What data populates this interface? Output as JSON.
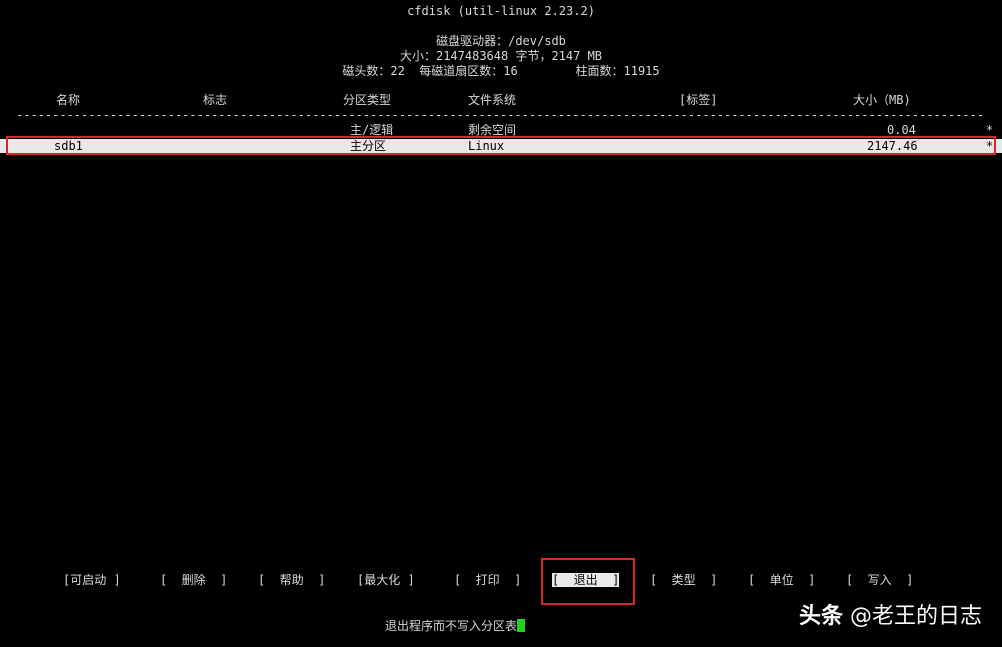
{
  "program_title": "cfdisk (util-linux 2.23.2)",
  "disk_info": {
    "drive_line": "磁盘驱动器：/dev/sdb",
    "size_line": "大小：2147483648 字节，2147 MB",
    "geometry_line": "磁头数：22  每磁道扇区数：16        柱面数：11915"
  },
  "table": {
    "columns": {
      "name": "名称",
      "flags": "标志",
      "part_type": "分区类型",
      "fs_type": "文件系统",
      "label": "[标签]",
      "size": "大小（MB)"
    },
    "divider": "----------------------------------------------------------------------------------------------------------------------------------------------------------------------------------------",
    "rows": [
      {
        "name": "",
        "flags": "",
        "part_type": "主/逻辑",
        "fs_type": "剩余空间",
        "label": "",
        "size": "0.04",
        "marker": "*"
      },
      {
        "name": "sdb1",
        "flags": "",
        "part_type": "主分区",
        "fs_type": "Linux",
        "label": "",
        "size": "2147.46",
        "marker": "*"
      }
    ]
  },
  "menu": {
    "bootable": "[可启动 ]",
    "delete": "[  删除  ]",
    "help": "[  帮助  ]",
    "maximize": "[最大化 ]",
    "print": "[  打印  ]",
    "quit": "[  退出  ]",
    "type": "[  类型  ]",
    "units": "[  单位  ]",
    "write": "[  写入  ]"
  },
  "status_message": "退出程序而不写入分区表",
  "watermark": {
    "brand": "头条",
    "author": " @老王的日志"
  },
  "colors": {
    "background": "#000000",
    "text": "#d8d8d8",
    "highlight": "#e8e8e8",
    "annotation_red": "#d9262c",
    "cursor_green": "#1fd31f"
  }
}
